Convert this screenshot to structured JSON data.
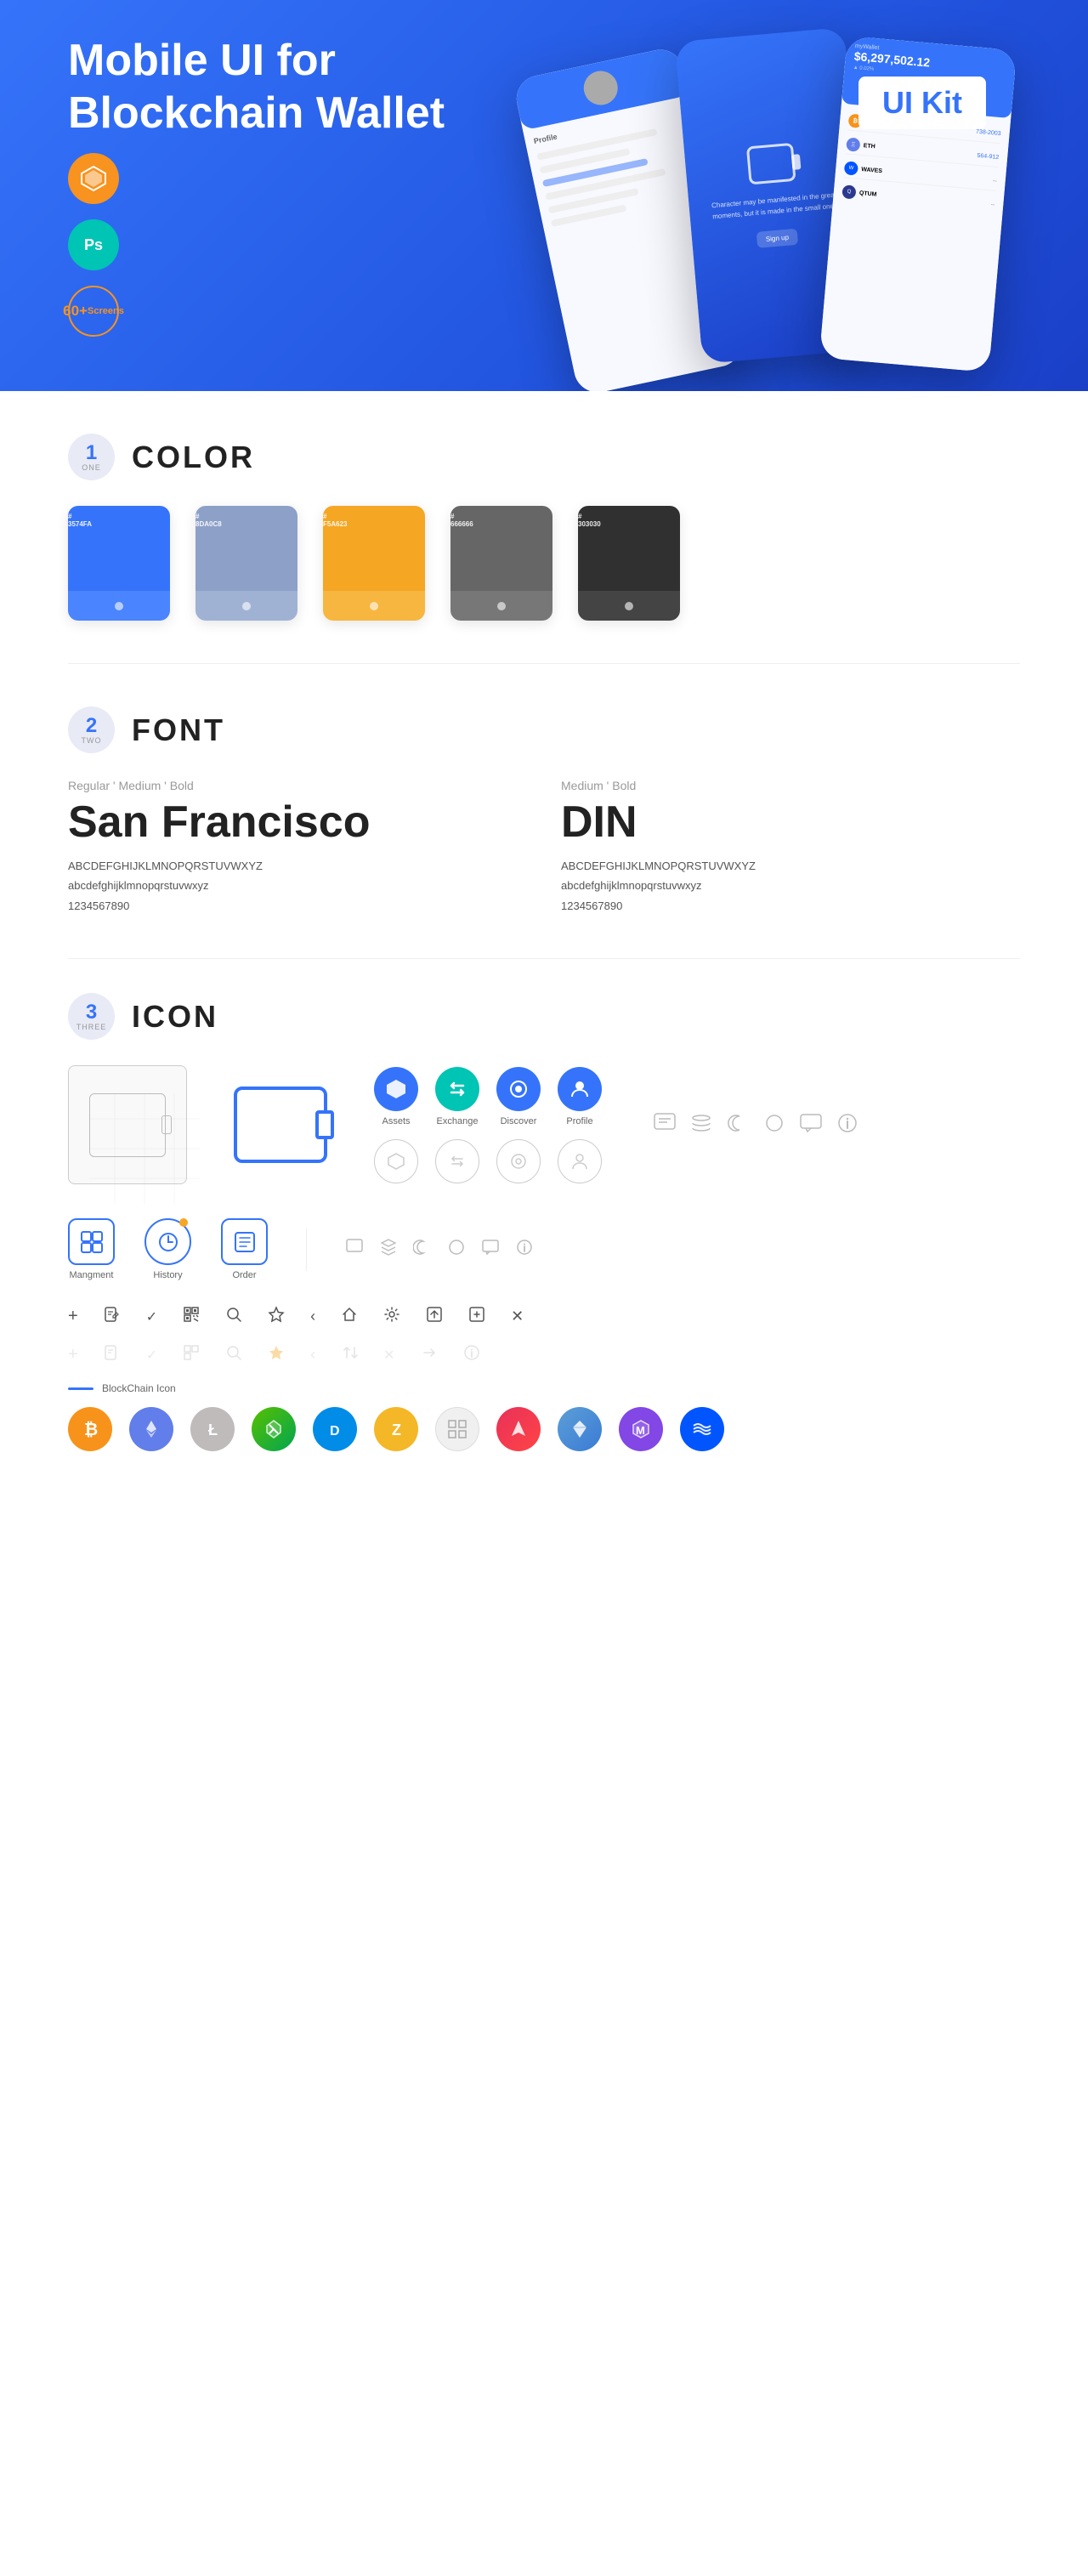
{
  "hero": {
    "title_regular": "Mobile UI for Blockchain ",
    "title_bold": "Wallet",
    "badge": "UI Kit",
    "badge_sketch": "S",
    "badge_ps": "Ps",
    "screens_num": "60+",
    "screens_label": "Screens"
  },
  "sections": {
    "color": {
      "number": "1",
      "number_label": "ONE",
      "title": "COLOR",
      "swatches": [
        {
          "hex": "#3574FA",
          "code": "#\n3574FA",
          "bottom": "#d0dcff"
        },
        {
          "hex": "#8DA0C8",
          "code": "#\n8DA0C8",
          "bottom": "#c5cfdf"
        },
        {
          "hex": "#F5A623",
          "code": "#\nF5A623",
          "bottom": "#ffd580"
        },
        {
          "hex": "#666666",
          "code": "#\n666666",
          "bottom": "#aaa"
        },
        {
          "hex": "#303030",
          "code": "#\n303030",
          "bottom": "#555"
        }
      ]
    },
    "font": {
      "number": "2",
      "number_label": "TWO",
      "title": "FONT",
      "font1": {
        "label": "Regular ' Medium ' Bold",
        "name": "San Francisco",
        "upper": "ABCDEFGHIJKLMNOPQRSTUVWXYZ",
        "lower": "abcdefghijklmnopqrstuvwxyz",
        "nums": "1234567890"
      },
      "font2": {
        "label": "Medium ' Bold",
        "name": "DIN",
        "upper": "ABCDEFGHIJKLMNOPQRSTUVWXYZ",
        "lower": "abcdefghijklmnopqrstuvwxyz",
        "nums": "1234567890"
      }
    },
    "icon": {
      "number": "3",
      "number_label": "THREE",
      "title": "ICON",
      "nav_icons": [
        {
          "label": "Assets",
          "glyph": "◆"
        },
        {
          "label": "Exchange",
          "glyph": "⇄"
        },
        {
          "label": "Discover",
          "glyph": "◉"
        },
        {
          "label": "Profile",
          "glyph": "👤"
        }
      ],
      "bottom_icons": [
        {
          "label": "Mangment",
          "type": "box"
        },
        {
          "label": "History",
          "type": "clock"
        },
        {
          "label": "Order",
          "type": "list"
        }
      ],
      "small_icons": [
        "+",
        "⊞",
        "✓",
        "▦",
        "🔍",
        "☆",
        "‹",
        "«",
        "⚙",
        "⊡",
        "⇌",
        "✕"
      ],
      "blockchain_label": "BlockChain Icon",
      "cryptos": [
        {
          "name": "BTC",
          "symbol": "₿",
          "class": "ci-btc"
        },
        {
          "name": "ETH",
          "symbol": "Ξ",
          "class": "ci-eth"
        },
        {
          "name": "LTC",
          "symbol": "Ł",
          "class": "ci-ltc"
        },
        {
          "name": "NEO",
          "symbol": "N",
          "class": "ci-neo"
        },
        {
          "name": "DASH",
          "symbol": "D",
          "class": "ci-dash"
        },
        {
          "name": "ZEC",
          "symbol": "Z",
          "class": "ci-zcash"
        },
        {
          "name": "IOTA",
          "symbol": "I",
          "class": "ci-iota"
        },
        {
          "name": "ARK",
          "symbol": "A",
          "class": "ci-ark"
        },
        {
          "name": "GEM",
          "symbol": "G",
          "class": "ci-gem"
        },
        {
          "name": "MATIC",
          "symbol": "M",
          "class": "ci-matic"
        }
      ]
    }
  }
}
